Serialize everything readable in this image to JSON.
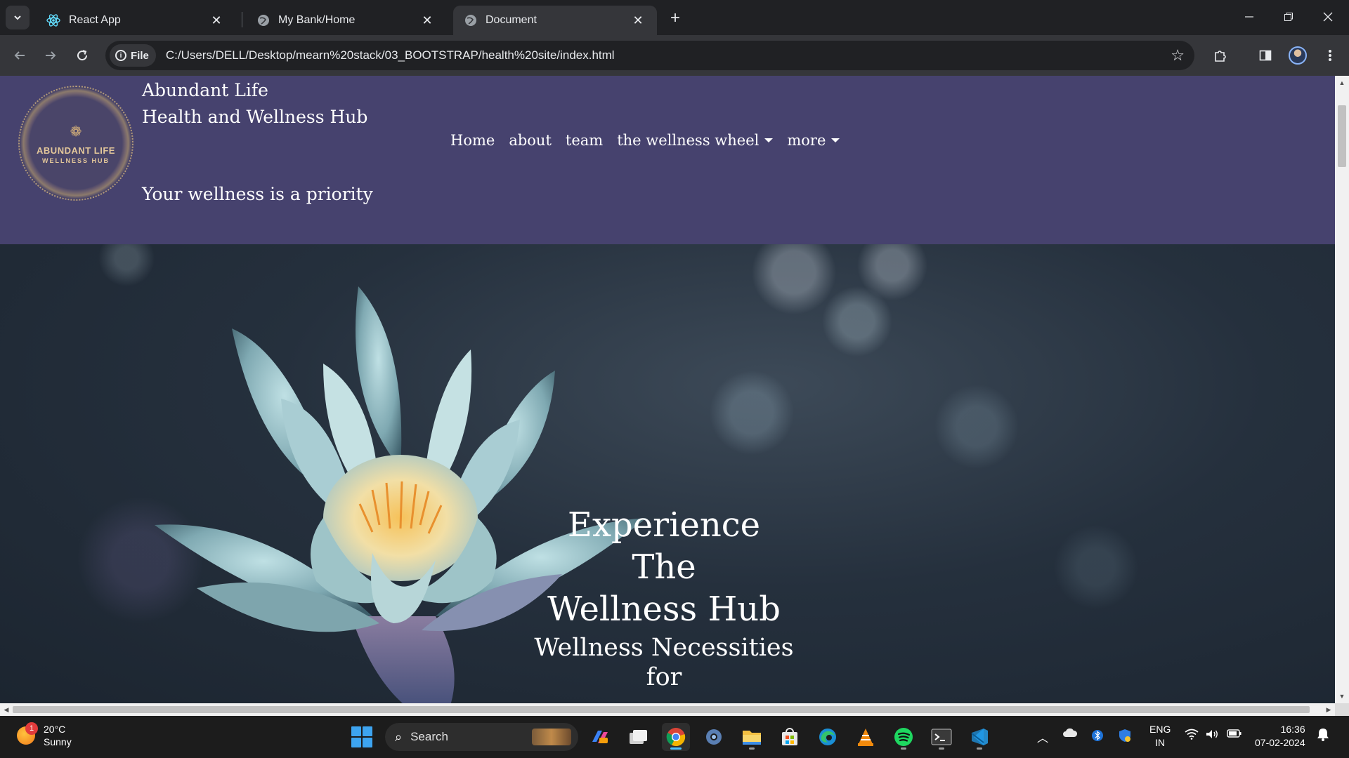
{
  "browser": {
    "tabs": [
      {
        "title": "React App",
        "icon": "react-icon",
        "active": false
      },
      {
        "title": "My Bank/Home",
        "icon": "globe-icon",
        "active": false
      },
      {
        "title": "Document",
        "icon": "globe-icon",
        "active": true
      }
    ],
    "address": {
      "chip_label": "File",
      "url": "C:/Users/DELL/Desktop/mearn%20stack/03_BOOTSTRAP/health%20site/index.html"
    }
  },
  "site": {
    "brand_line1": "Abundant Life",
    "brand_line2": "Health and Wellness Hub",
    "tagline": "Your wellness is a priority",
    "logo_line1": "ABUNDANT LIFE",
    "logo_line2": "WELLNESS HUB",
    "nav": [
      {
        "label": "Home",
        "dropdown": false
      },
      {
        "label": "about",
        "dropdown": false
      },
      {
        "label": "team",
        "dropdown": false
      },
      {
        "label": "the wellness wheel",
        "dropdown": true
      },
      {
        "label": "more",
        "dropdown": true
      }
    ],
    "hero": {
      "title_lines": [
        "Experience",
        "The",
        "Wellness Hub"
      ],
      "subtitle_lines": [
        "Wellness Necessities",
        "for"
      ]
    },
    "colors": {
      "header_bg": "#46426e",
      "hero_bg": "#1f2a38"
    }
  },
  "taskbar": {
    "weather": {
      "temp": "20°C",
      "condition": "Sunny",
      "badge": "1"
    },
    "search_label": "Search",
    "apps": [
      "copilot-icon",
      "task-view-icon",
      "chrome-icon",
      "settings-icon",
      "file-explorer-icon",
      "store-icon",
      "edge-icon",
      "vlc-icon",
      "spotify-icon",
      "terminal-icon",
      "vscode-icon"
    ],
    "lang_line1": "ENG",
    "lang_line2": "IN",
    "time": "16:36",
    "date": "07-02-2024"
  }
}
